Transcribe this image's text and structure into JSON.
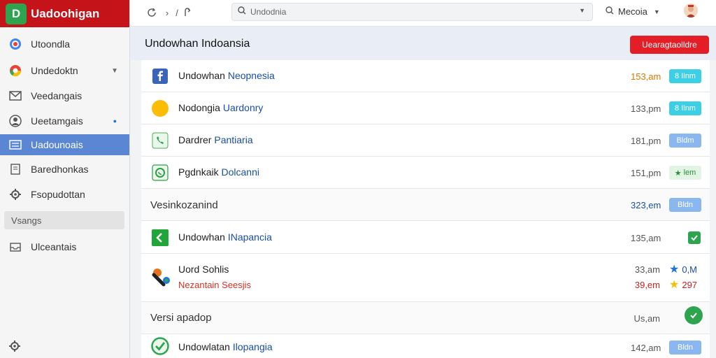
{
  "brand": {
    "title": "Uadoohigan"
  },
  "sidebar": {
    "items": [
      {
        "label": "Utoondla"
      },
      {
        "label": "Undedoktn"
      },
      {
        "label": "Veedangais"
      },
      {
        "label": "Ueetamgais"
      },
      {
        "label": "Uadounoais"
      },
      {
        "label": "Baredhonkas"
      },
      {
        "label": "Fsopudottan"
      }
    ],
    "section_label": "Vsangs",
    "last_item": {
      "label": "Ulceantais"
    }
  },
  "topbar": {
    "search_value": "Undodnia",
    "media_label": "Mecoia"
  },
  "main": {
    "title": "Undowhan Indoansia",
    "primary_action": "Uearagtaolldre"
  },
  "list": {
    "rows": [
      {
        "title_a": "Undowhan ",
        "title_b": "Neopnesia",
        "time": "153,am",
        "badge": "8 Ilnm"
      },
      {
        "title_a": "Nodongia ",
        "title_b": "Uardonry",
        "time": "133,pm",
        "badge": "8 Ilnm"
      },
      {
        "title_a": "Dardrer ",
        "title_b": "Pantiaria",
        "time": "181,pm",
        "badge": "Bldm"
      },
      {
        "title_a": "Pgdnkaik ",
        "title_b": "Dolcanni",
        "time": "151,pm",
        "badge": "lem"
      }
    ],
    "section1": {
      "title": "Vesinkozanind",
      "time": "323,em",
      "badge": "Bldn"
    },
    "row5": {
      "title_a": "Undowhan ",
      "title_b": "INapancia",
      "time": "135,am"
    },
    "row6": {
      "title": "Uord Sohlis",
      "subtitle": "Nezantain Seesjis",
      "time1": "33,am",
      "time2": "39,em",
      "stat1": "0,M",
      "stat2": "297"
    },
    "section2": {
      "title": "Versi apadop",
      "time": "Us,am"
    },
    "row7": {
      "title_a": "Undowlatan ",
      "title_b": "Ilopangia",
      "time": "142,am",
      "badge": "Bldn"
    }
  },
  "colors": {
    "brand": "#c5131a",
    "accent_blue": "#5b86d3",
    "primary_red": "#e41e26",
    "success_green": "#2ea44f"
  },
  "icons": {
    "top": [
      "refresh-icon",
      "more-icon",
      "back-icon",
      "search-icon",
      "chevron-down-icon",
      "avatar"
    ],
    "rows": [
      "facebook-icon",
      "circle-icon",
      "phone-icon",
      "whatsapp-icon",
      "check-icon",
      "apps-icon",
      "check-circle-icon",
      "star-icon"
    ]
  }
}
